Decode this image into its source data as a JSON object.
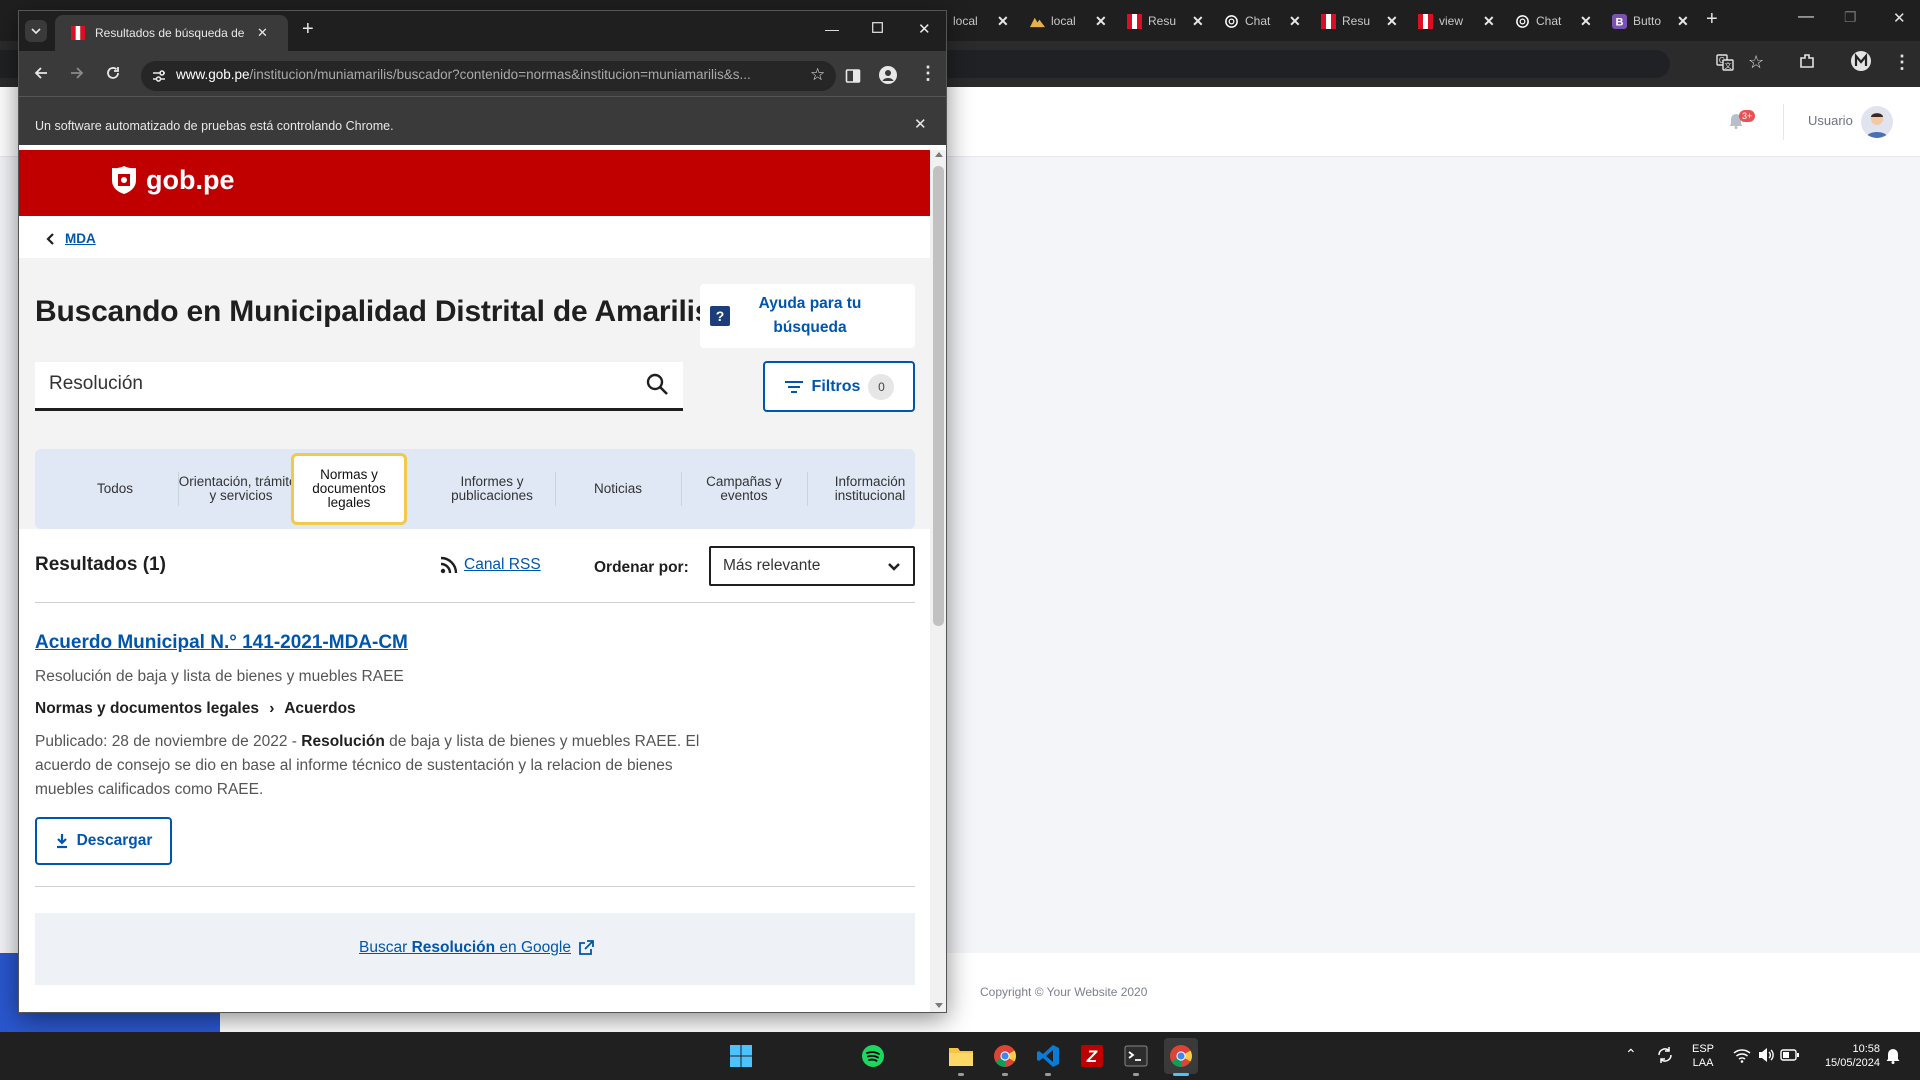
{
  "bg_browser": {
    "tabs": [
      {
        "title": "local",
        "icon": "globe-icon",
        "color": "#9aa0a6"
      },
      {
        "title": "local",
        "icon": "mountains-icon",
        "color": "#e8b04b"
      },
      {
        "title": "Resul",
        "icon": "peru-flag-icon",
        "color": "#d91023"
      },
      {
        "title": "Chat",
        "icon": "openai-icon",
        "color": "#ffffff"
      },
      {
        "title": "Resu",
        "icon": "peru-flag-icon",
        "color": "#d91023"
      },
      {
        "title": "view",
        "icon": "peru-flag-icon",
        "color": "#d91023"
      },
      {
        "title": "Chat",
        "icon": "openai-icon",
        "color": "#ffffff"
      },
      {
        "title": "Butto",
        "icon": "bootstrap-icon",
        "color": "#7952b3"
      }
    ],
    "header": {
      "user_label": "Usuario",
      "notification_badge": "3+"
    },
    "footer": {
      "copyright": "Copyright © Your Website 2020"
    }
  },
  "window": {
    "tab_title": "Resultados de búsqueda de Mu",
    "url_host": "www.gob.pe",
    "url_rest": "/institucion/muniamarilis/buscador?contenido=normas&institucion=muniamarilis&s...",
    "infobar_text": "Un software automatizado de pruebas está controlando Chrome."
  },
  "page": {
    "brand": "gob.pe",
    "breadcrumb": "MDA",
    "title": "Buscando en Municipalidad Distrital de Amarilis",
    "help_button": "Ayuda para tu búsqueda",
    "search_value": "Resolución",
    "filters_label": "Filtros",
    "filters_count": "0",
    "tabs": [
      "Todos",
      "Orientación, trámites y servicios",
      "Normas y documentos legales",
      "Informes y publicaciones",
      "Noticias",
      "Campañas y eventos",
      "Información institucional"
    ],
    "active_tab_index": 2,
    "results_count": "Resultados (1)",
    "rss_label": "Canal RSS",
    "sort_label": "Ordenar por:",
    "sort_value": "Más relevante",
    "result": {
      "title": "Acuerdo Municipal N.° 141-2021-MDA-CM",
      "subtitle": "Resolución de baja y lista de bienes y muebles RAEE",
      "category": "Normas y documentos legales",
      "subcategory": "Acuerdos",
      "category_sep": "›",
      "published_prefix": "Publicado: 28 de noviembre de 2022 - ",
      "highlight": "Resolución",
      "description_rest": " de baja y lista de bienes y muebles RAEE. El acuerdo de consejo se dio en base al informe técnico de sustentación y la relacion de bienes muebles calificados como RAEE.",
      "download_label": "Descargar"
    },
    "google_prefix": "Buscar ",
    "google_term": "Resolución",
    "google_suffix": " en Google"
  },
  "taskbar": {
    "language": "ESP",
    "layout": "LAA",
    "time": "10:58",
    "date": "15/05/2024"
  },
  "colors": {
    "gob_red": "#c00000",
    "link_blue": "#0056ac",
    "active_tab_border": "#f2c94c"
  }
}
